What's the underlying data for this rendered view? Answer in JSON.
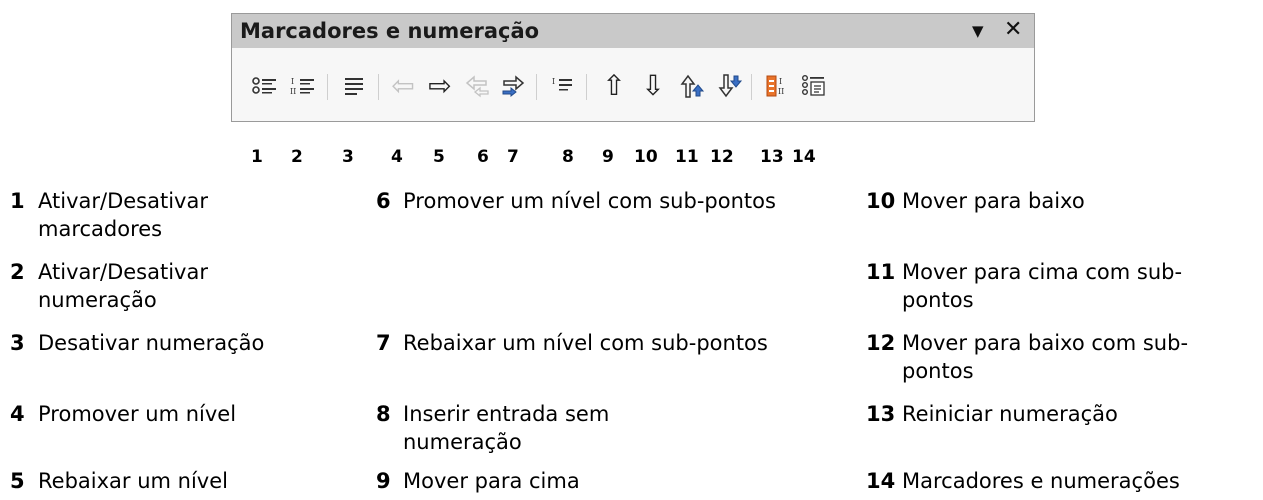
{
  "panel": {
    "title": "Marcadores e numeração",
    "dropdown_glyph": "▼",
    "close_glyph": "✕"
  },
  "toolbar": {
    "buttons": [
      {
        "icon": "bullets-icon"
      },
      {
        "icon": "numbering-icon"
      },
      {
        "icon": "no-list-icon"
      },
      {
        "icon": "promote-icon",
        "disabled": true
      },
      {
        "icon": "demote-icon"
      },
      {
        "icon": "promote-with-subpoints-icon",
        "disabled": true
      },
      {
        "icon": "demote-with-subpoints-icon"
      },
      {
        "icon": "insert-unnumbered-entry-icon"
      },
      {
        "icon": "move-up-icon"
      },
      {
        "icon": "move-down-icon"
      },
      {
        "icon": "move-up-with-subpoints-icon"
      },
      {
        "icon": "move-down-with-subpoints-icon"
      },
      {
        "icon": "restart-numbering-icon"
      },
      {
        "icon": "bullets-and-numbering-icon"
      }
    ]
  },
  "numbers": [
    "1",
    "2",
    "3",
    "4",
    "5",
    "6",
    "7",
    "8",
    "9",
    "10",
    "11",
    "12",
    "13",
    "14"
  ],
  "legend": [
    {
      "num": "1",
      "text": "Ativar/Desativar marcadores"
    },
    {
      "num": "2",
      "text": "Ativar/Desativar numeração"
    },
    {
      "num": "3",
      "text": "Desativar numeração"
    },
    {
      "num": "4",
      "text": "Promover um nível"
    },
    {
      "num": "5",
      "text": "Rebaixar um nível"
    },
    {
      "num": "6",
      "text": "Promover um nível com sub-pontos"
    },
    {
      "num": "7",
      "text": "Rebaixar um nível com sub-pontos"
    },
    {
      "num": "8",
      "text": "Inserir entrada sem numeração"
    },
    {
      "num": "9",
      "text": "Mover para cima"
    },
    {
      "num": "10",
      "text": "Mover para baixo"
    },
    {
      "num": "11",
      "text": "Mover para cima com sub-pontos"
    },
    {
      "num": "12",
      "text": "Mover para baixo com sub-pontos"
    },
    {
      "num": "13",
      "text": "Reiniciar numeração"
    },
    {
      "num": "14",
      "text": "Marcadores e numerações"
    }
  ]
}
